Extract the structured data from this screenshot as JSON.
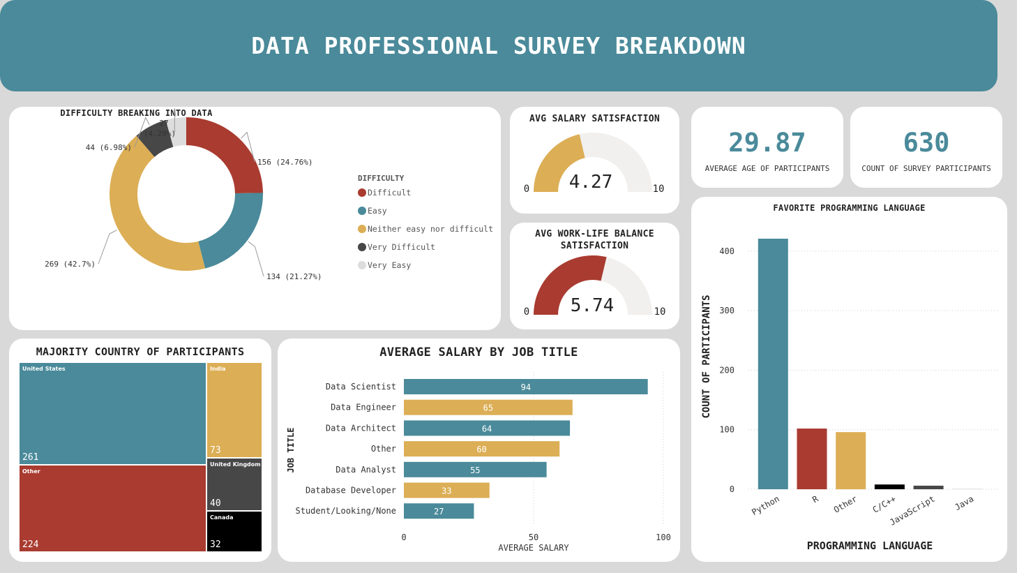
{
  "header": {
    "title": "DATA PROFESSIONAL SURVEY BREAKDOWN"
  },
  "colors": {
    "teal": "#4a8a9a",
    "red": "#a93b30",
    "gold": "#dcae55",
    "dark": "#474747",
    "light": "#dddddd",
    "black": "#000000"
  },
  "kpis": {
    "avg_age": {
      "value": "29.87",
      "label": "AVERAGE AGE OF PARTICIPANTS"
    },
    "count": {
      "value": "630",
      "label": "COUNT OF SURVEY PARTICIPANTS"
    }
  },
  "gauges": {
    "salary": {
      "title": "AVG SALARY SATISFACTION",
      "value": 4.27,
      "value_text": "4.27",
      "min": "0",
      "max": "10",
      "color": "#dcae55"
    },
    "worklife": {
      "title_line1": "AVG WORK-LIFE BALANCE",
      "title_line2": "SATISFACTION",
      "value": 5.74,
      "value_text": "5.74",
      "min": "0",
      "max": "10",
      "color": "#a93b30"
    }
  },
  "chart_data": [
    {
      "type": "pie",
      "title": "DIFFICULTY BREAKING INTO DATA",
      "legend_title": "DIFFICULTY",
      "legend_position": "right",
      "slices": [
        {
          "label": "Difficult",
          "value": 156,
          "pct": "24.76%",
          "color": "#a93b30"
        },
        {
          "label": "Easy",
          "value": 134,
          "pct": "21.27%",
          "color": "#4a8a9a"
        },
        {
          "label": "Neither easy nor difficult",
          "value": 269,
          "pct": "42.7%",
          "color": "#dcae55"
        },
        {
          "label": "Very Difficult",
          "value": 44,
          "pct": "6.98%",
          "color": "#474747"
        },
        {
          "label": "Very Easy",
          "value": 27,
          "pct": "4.29%",
          "color": "#dddddd"
        }
      ]
    },
    {
      "type": "treemap",
      "title": "MAJORITY COUNTRY OF PARTICIPANTS",
      "items": [
        {
          "label": "United States",
          "value": 261,
          "color": "#4a8a9a"
        },
        {
          "label": "Other",
          "value": 224,
          "color": "#a93b30"
        },
        {
          "label": "India",
          "value": 73,
          "color": "#dcae55"
        },
        {
          "label": "United Kingdom",
          "value": 40,
          "color": "#474747"
        },
        {
          "label": "Canada",
          "value": 32,
          "color": "#000000"
        }
      ]
    },
    {
      "type": "bar",
      "orientation": "horizontal",
      "title": "AVERAGE SALARY BY JOB TITLE",
      "xlabel": "AVERAGE SALARY",
      "ylabel": "JOB TITLE",
      "xlim": [
        0,
        100
      ],
      "xticks": [
        "0",
        "50",
        "100"
      ],
      "grid": true,
      "categories": [
        "Data Scientist",
        "Data Engineer",
        "Data Architect",
        "Other",
        "Data Analyst",
        "Database Developer",
        "Student/Looking/None"
      ],
      "values": [
        94,
        65,
        64,
        60,
        55,
        33,
        27
      ],
      "colors": [
        "#4a8a9a",
        "#dcae55",
        "#4a8a9a",
        "#dcae55",
        "#4a8a9a",
        "#dcae55",
        "#4a8a9a"
      ]
    },
    {
      "type": "bar",
      "title": "FAVORITE PROGRAMMING LANGUAGE",
      "xlabel": "PROGRAMMING LANGUAGE",
      "ylabel": "COUNT OF PARTICIPANTS",
      "ylim": [
        0,
        440
      ],
      "yticks": [
        "0",
        "100",
        "200",
        "300",
        "400"
      ],
      "grid": true,
      "categories": [
        "Python",
        "R",
        "Other",
        "C/C++",
        "JavaScript",
        "Java"
      ],
      "values": [
        421,
        102,
        96,
        8,
        6,
        1
      ],
      "colors": [
        "#4a8a9a",
        "#a93b30",
        "#dcae55",
        "#000000",
        "#474747",
        "#dddddd"
      ]
    }
  ]
}
